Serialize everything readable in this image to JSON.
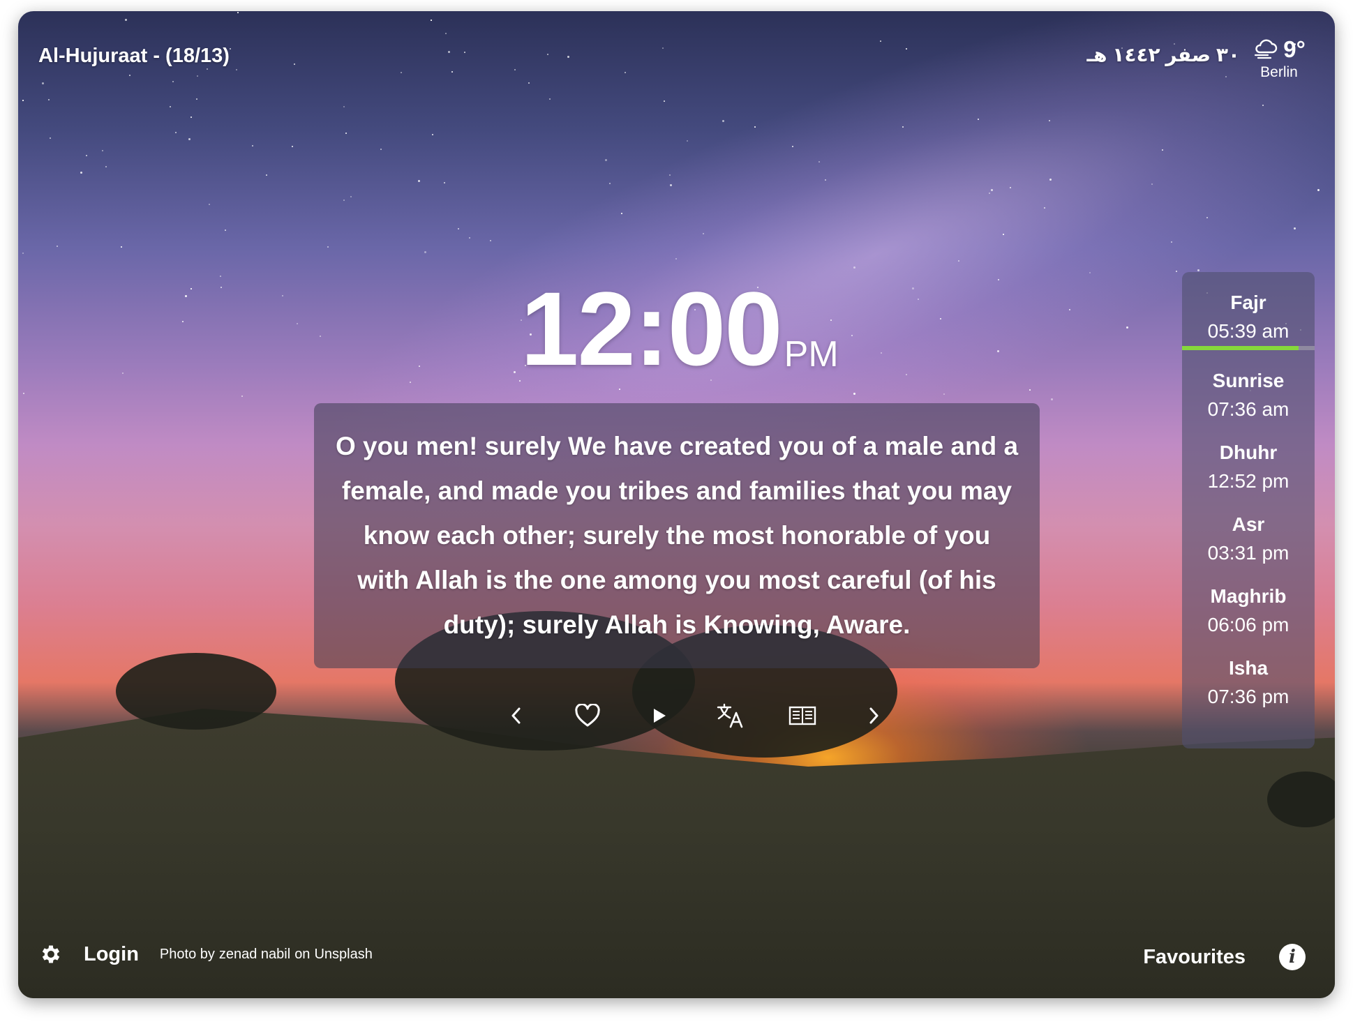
{
  "header": {
    "surah_label": "Al-Hujuraat - (18/13)",
    "hijri_date": "٣٠ صفر ١٤٤٢ هـ",
    "weather": {
      "icon": "cloudy-wind-icon",
      "temperature": "9°",
      "city": "Berlin"
    }
  },
  "clock": {
    "time": "12:00",
    "ampm": "PM"
  },
  "verse": {
    "text": "O you men! surely We have created you of a male and a female, and made you tribes and families that you may know each other; surely the most honorable of you with Allah is the one among you most careful (of his duty); surely Allah is Knowing, Aware."
  },
  "controls": {
    "icons": [
      "chevron-left-icon",
      "heart-icon",
      "play-icon",
      "translate-icon",
      "book-icon",
      "chevron-right-icon"
    ]
  },
  "prayers": {
    "current": {
      "name": "Fajr",
      "time": "05:39 am",
      "progress": 0.88
    },
    "accent_color": "#86d83c",
    "list": [
      {
        "name": "Sunrise",
        "time": "07:36 am"
      },
      {
        "name": "Dhuhr",
        "time": "12:52 pm"
      },
      {
        "name": "Asr",
        "time": "03:31 pm"
      },
      {
        "name": "Maghrib",
        "time": "06:06 pm"
      },
      {
        "name": "Isha",
        "time": "07:36 pm"
      }
    ]
  },
  "footer": {
    "login_label": "Login",
    "photo_by": "Photo by",
    "photographer": "zenad nabil",
    "on": "on",
    "source": "Unsplash",
    "favourites_label": "Favourites",
    "info_label": "i"
  }
}
